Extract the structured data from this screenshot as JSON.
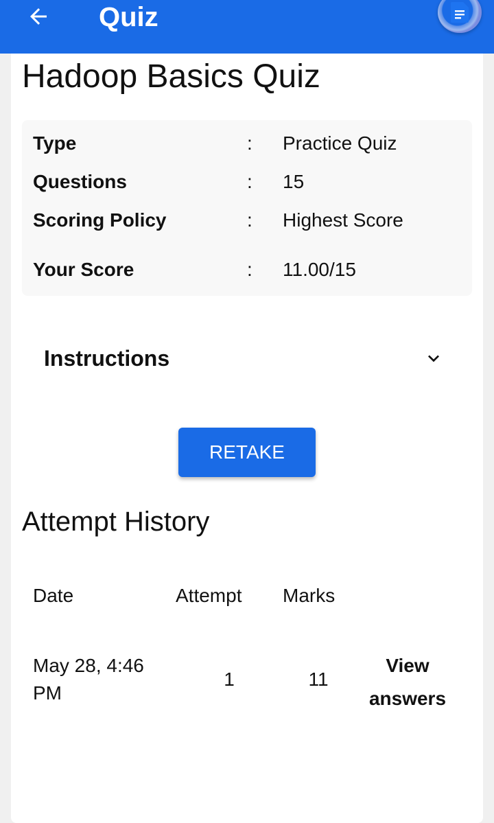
{
  "appbar": {
    "title": "Quiz",
    "back_icon": "arrow-left-icon",
    "action_icon": "document-icon",
    "color": "#1a6be6"
  },
  "quiz": {
    "title": "Hadoop Basics Quiz",
    "details": [
      {
        "label": "Type",
        "colon": ":",
        "value": "Practice Quiz"
      },
      {
        "label": "Questions",
        "colon": ":",
        "value": "15"
      },
      {
        "label": "Scoring Policy",
        "colon": ":",
        "value": "Highest Score"
      },
      {
        "label": "Your Score",
        "colon": ":",
        "value": "11.00/15"
      }
    ]
  },
  "instructions": {
    "label": "Instructions",
    "icon": "chevron-down-icon"
  },
  "retake": {
    "label": "RETAKE"
  },
  "history": {
    "title": "Attempt History",
    "columns": [
      "Date",
      "Attempt",
      "Marks"
    ],
    "rows": [
      {
        "date": "May 28, 4:46 PM",
        "attempt": "1",
        "marks": "11",
        "action": "View answers"
      }
    ]
  }
}
